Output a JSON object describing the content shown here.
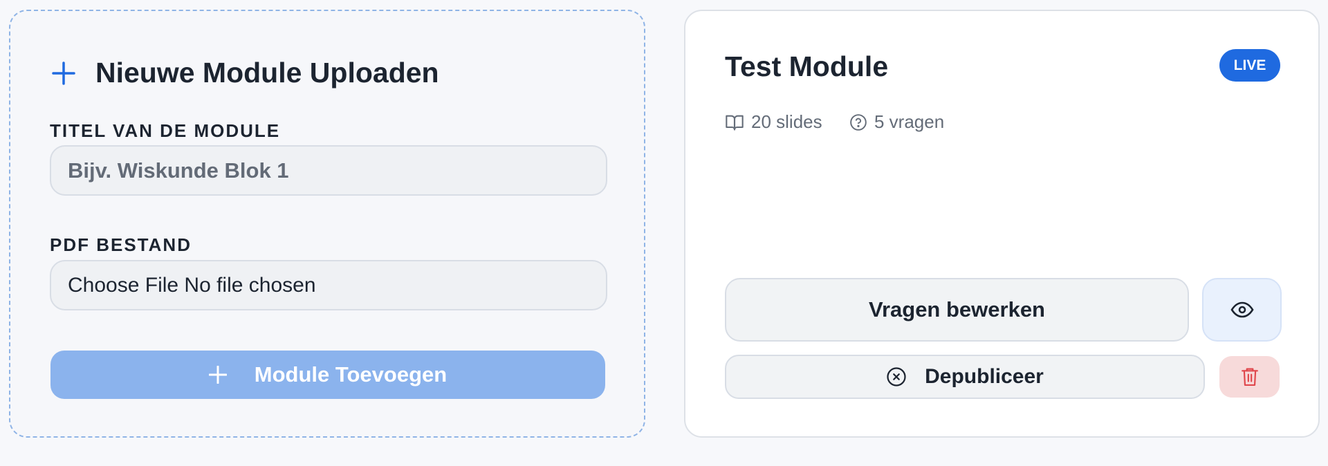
{
  "upload": {
    "title": "Nieuwe Module Uploaden",
    "title_label": "TITEL VAN DE MODULE",
    "title_placeholder": "Bijv. Wiskunde Blok 1",
    "pdf_label": "PDF BESTAND",
    "file_text": "Choose File No file chosen",
    "submit_label": "Module Toevoegen"
  },
  "module": {
    "title": "Test Module",
    "status": "LIVE",
    "slides": "20 slides",
    "questions": "5 vragen",
    "edit_label": "Vragen bewerken",
    "unpublish_label": "Depubliceer"
  },
  "colors": {
    "accent": "#1f6ae0",
    "submit_disabled": "#8bb3ed",
    "delete_bg": "#f7dada",
    "delete_icon": "#e0474c"
  },
  "icons": {
    "upload_title": "plus-icon",
    "submit": "plus-icon",
    "slides": "book-open-icon",
    "questions": "help-circle-icon",
    "view": "eye-icon",
    "unpublish": "x-circle-icon",
    "delete": "trash-icon"
  }
}
